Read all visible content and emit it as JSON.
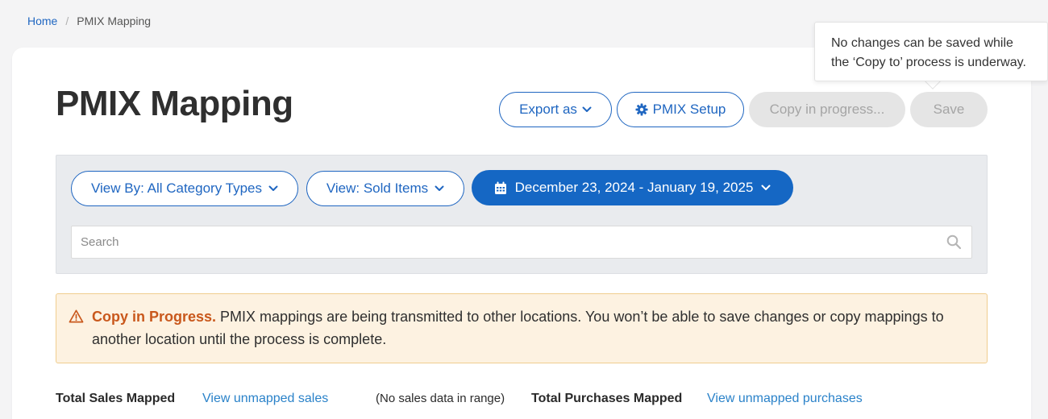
{
  "breadcrumb": {
    "home": "Home",
    "separator": "/",
    "current": "PMIX Mapping"
  },
  "page": {
    "title": "PMIX Mapping"
  },
  "toolbar": {
    "export_label": "Export as",
    "setup_label": "PMIX Setup",
    "copy_label": "Copy in progress...",
    "save_label": "Save"
  },
  "tooltip": {
    "line1": "No changes can be saved while",
    "line2": "the ‘Copy to’ process is underway."
  },
  "filters": {
    "view_by": "View By: All Category Types",
    "view": "View: Sold Items",
    "date_range": "December 23, 2024 - January 19, 2025",
    "search_placeholder": "Search"
  },
  "alert": {
    "title": "Copy in Progress.",
    "message": " PMIX mappings are being transmitted to other locations. You won’t be able to save changes or copy mappings to another location until the process is complete."
  },
  "stats": {
    "sales_label": "Total Sales Mapped",
    "sales_link": "View unmapped sales",
    "sales_note": "(No sales data in range)",
    "purchases_label": "Total Purchases Mapped",
    "purchases_link": "View unmapped purchases"
  },
  "colors": {
    "primary": "#1567c4",
    "link": "#2a82c9",
    "warning_bg": "#fdf2e1",
    "warning_border": "#f0cd8f",
    "warning_title": "#c9581c",
    "disabled_bg": "#e5e5e5"
  },
  "icons": {
    "export_chevron": "chevron-down-icon",
    "setup": "gear-icon",
    "date": "calendar-icon",
    "search": "search-icon",
    "alert": "warning-triangle-icon"
  }
}
